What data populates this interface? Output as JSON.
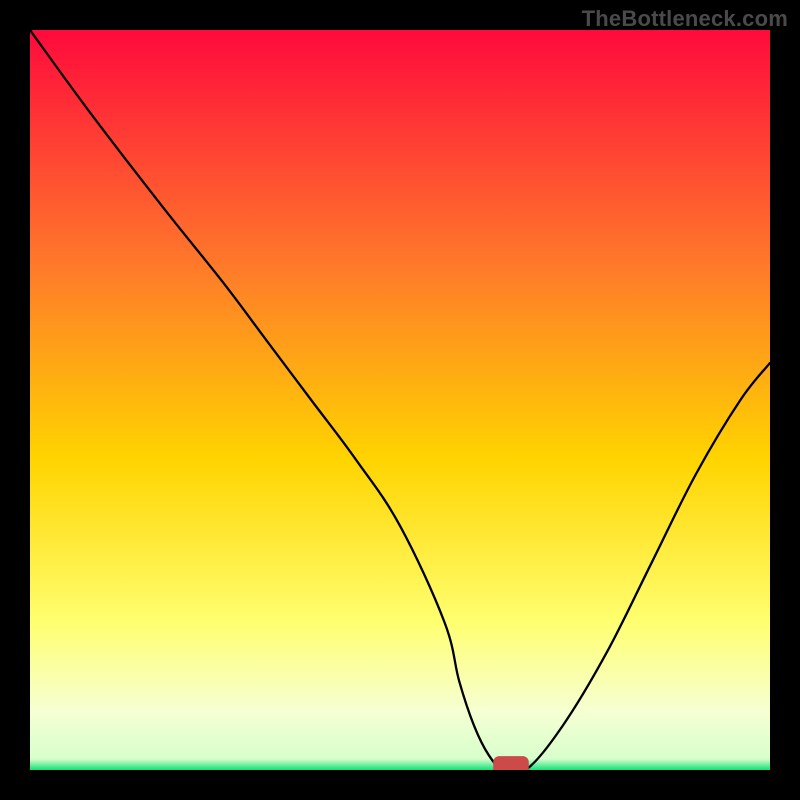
{
  "watermark": "TheBottleneck.com",
  "colors": {
    "top": "#ff0a3c",
    "mid_upper": "#ff7a2a",
    "mid": "#ffd400",
    "mid_lower": "#ffff70",
    "pale": "#f6ffd2",
    "green": "#12e07a",
    "curve": "#000000",
    "marker": "#cc4a4a"
  },
  "chart_data": {
    "type": "line",
    "title": "",
    "xlabel": "",
    "ylabel": "",
    "xlim": [
      0,
      100
    ],
    "ylim": [
      0,
      100
    ],
    "x": [
      0,
      8,
      18,
      26,
      32,
      38,
      44,
      50,
      56,
      58,
      60,
      62,
      64,
      67,
      72,
      78,
      84,
      90,
      96,
      100
    ],
    "values": [
      100,
      89,
      76,
      66,
      58,
      50,
      42,
      33,
      20,
      12,
      6,
      2,
      0,
      0,
      6,
      16,
      28,
      40,
      50,
      55
    ],
    "marker": {
      "x": 65,
      "y": 0,
      "width": 3,
      "height": 2
    },
    "notes": "V-shaped bottleneck curve; y is a relative mismatch percentage, minimum (optimal) near x≈65."
  }
}
